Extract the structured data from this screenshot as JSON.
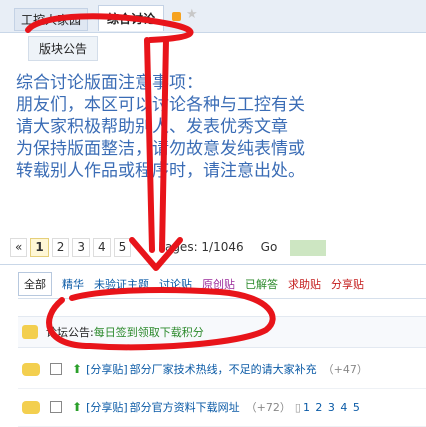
{
  "breadcrumb": {
    "item1": "工控人家园",
    "item2": "综合讨论"
  },
  "icons": {
    "rss": "rss-icon",
    "star": "star-icon"
  },
  "subtab": "版块公告",
  "notice": [
    "综合讨论版面注意事项：",
    "朋友们，本区可以讨论各种与工控有关",
    "请大家积极帮助别人、发表优秀文章",
    "为保持版面整洁，请勿故意发纯表情或",
    "转载别人作品或程序时，请注意出处。"
  ],
  "pager": {
    "prev": "«",
    "pages": [
      "1",
      "2",
      "3",
      "4",
      "5"
    ],
    "current": "1",
    "label": "Pages: 1/1046",
    "go": "Go"
  },
  "filters": [
    "全部",
    "精华",
    "未验证主题",
    "讨论贴",
    "原创贴",
    "已解答",
    "求助贴",
    "分享贴"
  ],
  "announcement": {
    "label": "论坛公告:",
    "text": "每日签到领取下载积分"
  },
  "threads": [
    {
      "category": "[分享贴]",
      "title": "部分厂家技术热线，不足的请大家补充",
      "count": "（+47）",
      "pages": ""
    },
    {
      "category": "[分享贴]",
      "title": "部分官方资料下载网址",
      "count": "（+72）",
      "pages": "1 2 3 4 5"
    }
  ],
  "colors": {
    "annotation": "#e8141a",
    "notice": "#3a6cb5"
  }
}
